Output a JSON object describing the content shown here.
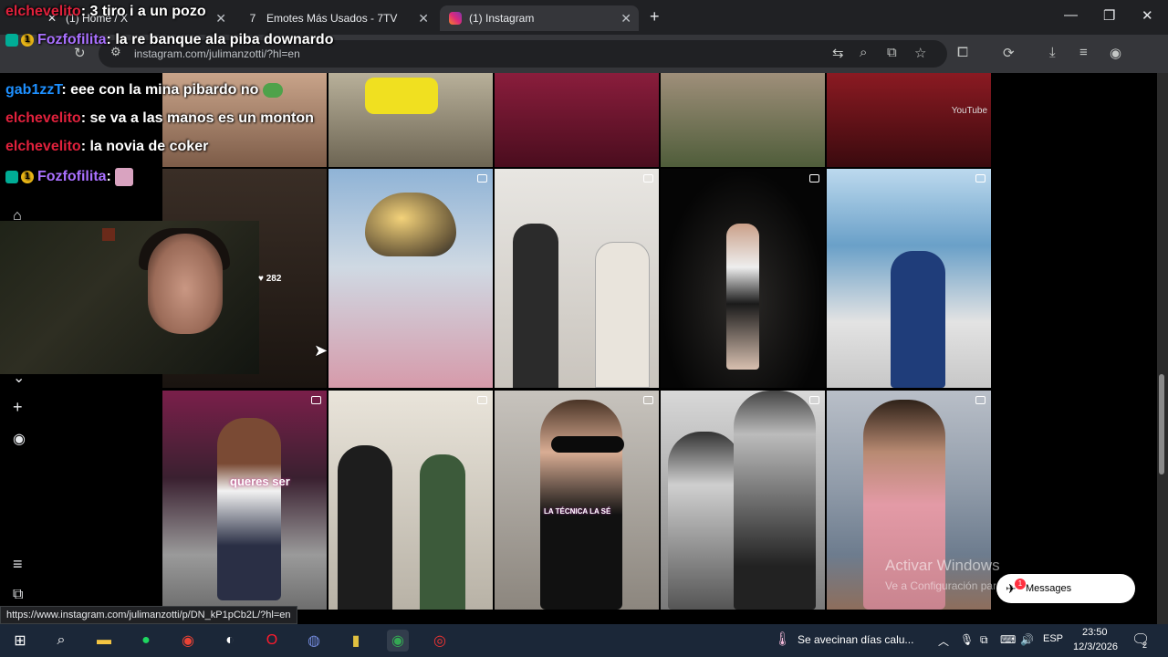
{
  "browser": {
    "tabs": [
      {
        "label": "(1) Home / X",
        "icon": "x-logo-icon"
      },
      {
        "label": "Emotes Más Usados - 7TV",
        "icon": "7tv-logo-icon"
      },
      {
        "label": "(1) Instagram",
        "icon": "instagram-logo-icon",
        "active": true
      }
    ],
    "new_tab_label": "+",
    "url": "instagram.com/julimanzotti/?hl=en",
    "status_url": "https://www.instagram.com/julimanzotti/p/DN_kP1pCb2L/?hl=en"
  },
  "chat": {
    "messages": [
      {
        "user": "elchevelito",
        "text": ": 3 tiro i a un pozo",
        "color": "red"
      },
      {
        "user": "Fozfofilita",
        "text": ": la re banque ala piba downardo",
        "color": "purple",
        "badges": true
      },
      {
        "user": "gab1zzT",
        "text": ": eee con la mina pibardo no",
        "color": "blue"
      },
      {
        "user": "elchevelito",
        "text": ": se va a las manos es un monton",
        "color": "red"
      },
      {
        "user": "elchevelito",
        "text": ": la novia de coker",
        "color": "red"
      },
      {
        "user": "Fozfofilita",
        "text": ":",
        "color": "purple",
        "badges": true
      }
    ]
  },
  "post_overlays": {
    "like_count": "282",
    "caption_queres": "queres ser",
    "caption_tecnica": "LA TÉCNICA LA SÉ",
    "youtube_text": "YouTube"
  },
  "watermark": {
    "line1": "Activar Windows",
    "line2": "Ve a Configuración para activar Windows."
  },
  "messages_button": {
    "label": "Messages",
    "badge": "1"
  },
  "taskbar": {
    "weather_text": "Se avecinan días calu...",
    "language": "ESP",
    "time": "23:50",
    "date": "12/3/2026",
    "notifications": "2"
  },
  "colors": {
    "chrome_dark": "#202124",
    "chrome_toolbar": "#35363a",
    "taskbar": "#1b2738",
    "chat_red": "#e0213c",
    "chat_purple": "#a970ff"
  }
}
